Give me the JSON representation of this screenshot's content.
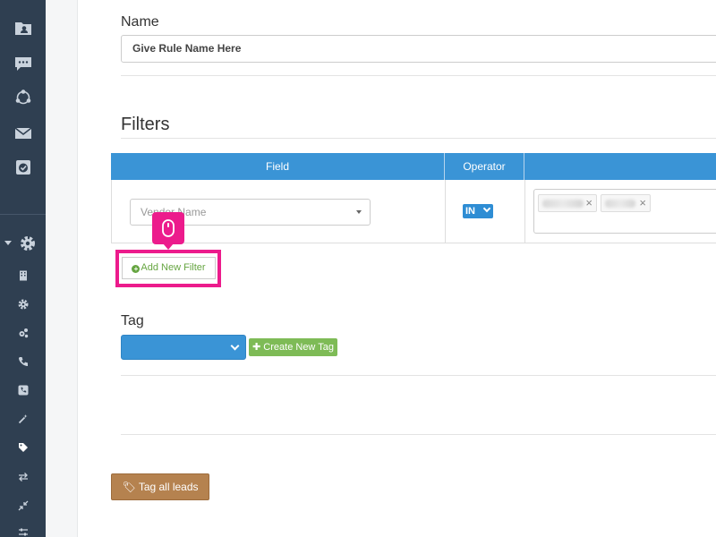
{
  "form": {
    "name_label": "Name",
    "name_value": "Give Rule Name Here",
    "filters_title": "Filters",
    "table": {
      "headers": [
        "Field",
        "Operator",
        ""
      ],
      "rows": [
        {
          "field_placeholder": "Vendor Name",
          "operator": "IN"
        }
      ]
    },
    "add_filter_label": "Add New Filter",
    "tag_label": "Tag",
    "create_tag_label": "Create New Tag",
    "tag_all_label": "Tag all leads"
  },
  "icons": {
    "sidebar": [
      "folder-user-icon",
      "chat-icon",
      "network-icon",
      "mail-icon",
      "checklist-icon",
      "gear-icon",
      "building-icon",
      "cog-icon",
      "cogs-icon",
      "phone-icon",
      "phone-square-icon",
      "magic-wand-icon",
      "tag-icon",
      "exchange-icon",
      "compress-icon",
      "sliders-icon"
    ]
  },
  "colors": {
    "sidebar_bg": "#2f3f51",
    "header_blue": "#3a94d6",
    "highlight_pink": "#ec1b8c",
    "add_green": "#66a541",
    "create_tag_green": "#7ebb56",
    "tag_all_brown": "#b5824f"
  }
}
